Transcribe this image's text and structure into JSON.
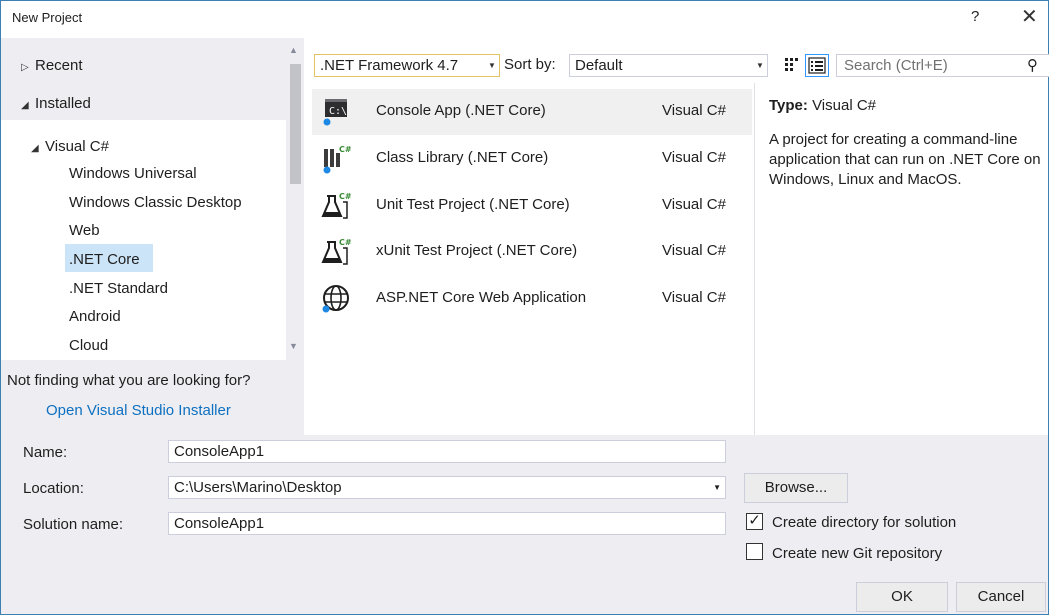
{
  "window": {
    "title": "New Project",
    "help": "?",
    "close": "✕"
  },
  "tree": {
    "recent": "Recent",
    "installed": "Installed",
    "visual_csharp": "Visual C#",
    "items": [
      "Windows Universal",
      "Windows Classic Desktop",
      "Web",
      ".NET Core",
      ".NET Standard",
      "Android",
      "Cloud"
    ],
    "selected": ".NET Core"
  },
  "not_finding": "Not finding what you are looking for?",
  "installer_link": "Open Visual Studio Installer",
  "toolbar": {
    "framework": ".NET Framework 4.7",
    "sort_label": "Sort by:",
    "sort_value": "Default",
    "search_placeholder": "Search (Ctrl+E)"
  },
  "templates": [
    {
      "name": "Console App (.NET Core)",
      "lang": "Visual C#",
      "icon": "console-app-icon"
    },
    {
      "name": "Class Library (.NET Core)",
      "lang": "Visual C#",
      "icon": "class-library-icon"
    },
    {
      "name": "Unit Test Project (.NET Core)",
      "lang": "Visual C#",
      "icon": "unit-test-icon"
    },
    {
      "name": "xUnit Test Project (.NET Core)",
      "lang": "Visual C#",
      "icon": "xunit-test-icon"
    },
    {
      "name": "ASP.NET Core Web Application",
      "lang": "Visual C#",
      "icon": "globe-icon"
    }
  ],
  "description": {
    "type_label": "Type:",
    "type_value": "Visual C#",
    "text": "A project for creating a command-line application that can run on .NET Core on Windows, Linux and MacOS."
  },
  "form": {
    "name_label": "Name:",
    "name_value": "ConsoleApp1",
    "location_label": "Location:",
    "location_value": "C:\\Users\\Marino\\Desktop",
    "solution_label": "Solution name:",
    "solution_value": "ConsoleApp1",
    "browse": "Browse...",
    "create_dir": "Create directory for solution",
    "create_dir_checked": true,
    "create_git": "Create new Git repository",
    "create_git_checked": false,
    "ok": "OK",
    "cancel": "Cancel"
  },
  "colors": {
    "accent": "#3c7fb1",
    "link": "#0e70c0",
    "selection": "#cce4f7",
    "panel": "#eeeef2"
  }
}
